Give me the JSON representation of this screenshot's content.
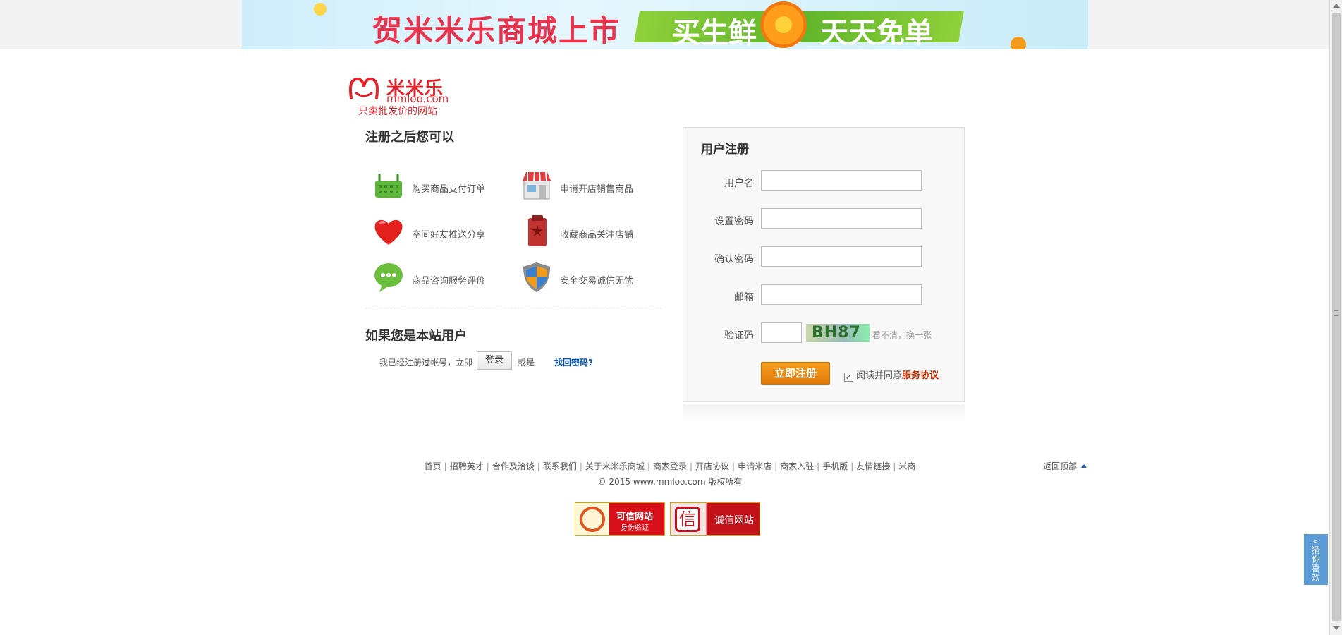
{
  "banner": {
    "title": "贺米米乐商城上市",
    "slogan_left": "买生鲜",
    "slogan_right": "天天免单"
  },
  "logo": {
    "name": "米米乐",
    "domain": "mmloo.com",
    "slogan": "只卖批发价的网站"
  },
  "benefits": {
    "title": "注册之后您可以",
    "items": [
      {
        "label": "购买商品支付订单",
        "icon": "basket-icon"
      },
      {
        "label": "申请开店销售商品",
        "icon": "shop-icon"
      },
      {
        "label": "空间好友推送分享",
        "icon": "heart-icon"
      },
      {
        "label": "收藏商品关注店铺",
        "icon": "bookmark-icon"
      },
      {
        "label": "商品咨询服务评价",
        "icon": "chat-icon"
      },
      {
        "label": "安全交易诚信无忧",
        "icon": "shield-icon"
      }
    ]
  },
  "existing": {
    "title": "如果您是本站用户",
    "text_before": "我已经注册过帐号，立即",
    "login_label": "登录",
    "text_or": "或是",
    "recover_link": "找回密码?"
  },
  "form": {
    "title": "用户注册",
    "username_label": "用户名",
    "password_label": "设置密码",
    "confirm_label": "确认密码",
    "email_label": "邮箱",
    "captcha_label": "验证码",
    "captcha_text": "BH87",
    "captcha_refresh": "看不清，换一张",
    "submit_label": "立即注册",
    "agree_text": "阅读并同意",
    "agreement_link": "服务协议",
    "agree_checked": true
  },
  "footer": {
    "links": [
      "首页",
      "招聘英才",
      "合作及洽谈",
      "联系我们",
      "关于米米乐商城",
      "商家登录",
      "开店协议",
      "申请米店",
      "商家入驻",
      "手机版",
      "友情链接",
      "米商"
    ],
    "copyright": "© 2015 www.mmloo.com 版权所有",
    "back_to_top": "返回顶部",
    "badge1_title": "可信网站",
    "badge1_sub": "身份验证",
    "badge2_icon": "信",
    "badge2_title": "诚信网站"
  },
  "side_tab": {
    "label": "猜你喜欢"
  },
  "colors": {
    "brand_red": "#e5252d",
    "button_orange": "#e17806",
    "link_blue": "#0a52b0",
    "side_tab_blue": "#5b9cd6"
  }
}
